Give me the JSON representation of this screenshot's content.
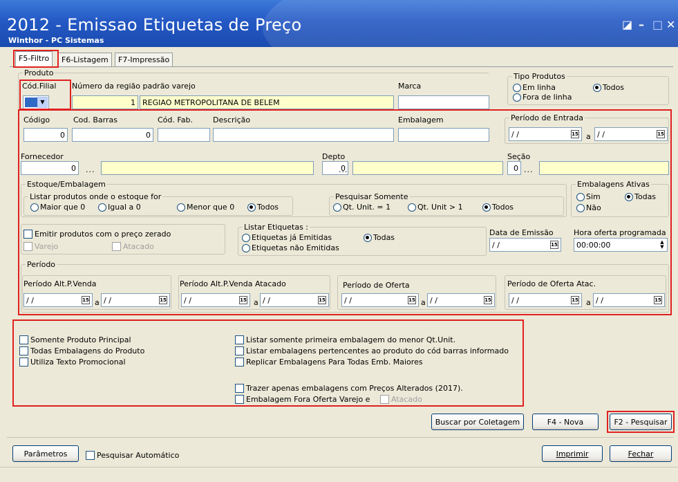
{
  "window": {
    "title": "2012 - Emissao Etiquetas de Preço",
    "subtitle": "Winthor - PC Sistemas"
  },
  "tabs": [
    "F5-Filtro",
    "F6-Listagem",
    "F7-Impressão"
  ],
  "produto": {
    "group": "Produto",
    "cod_filial_label": "Cód.Filial",
    "regiao_label": "Número da região padrão varejo",
    "regiao_num": "1",
    "regiao_name": "REGIAO METROPOLITANA DE BELEM",
    "marca_label": "Marca"
  },
  "tipo_produtos": {
    "group": "Tipo Produtos",
    "em_linha": "Em linha",
    "fora_linha": "Fora de linha",
    "todos": "Todos"
  },
  "fields": {
    "codigo_label": "Código",
    "codigo": "0",
    "barras_label": "Cod. Barras",
    "barras": "0",
    "codfab_label": "Cód. Fab.",
    "descricao_label": "Descrição",
    "embalagem_label": "Embalagem",
    "fornecedor_label": "Fornecedor",
    "fornecedor": "0",
    "depto_label": "Depto",
    "depto": "0",
    "secao_label": "Seção",
    "secao": "0",
    "ellipsis": "..."
  },
  "periodo_entrada": {
    "group": "Período de Entrada",
    "date1": "/ /",
    "date2": "/ /",
    "sep": "a",
    "cal": "15"
  },
  "estoque": {
    "group": "Estoque/Embalagem",
    "listar_group": "Listar produtos onde o estoque for",
    "opts": [
      "Maior que 0",
      "Igual a 0",
      "Menor que 0",
      "Todos"
    ],
    "pesquisar_group": "Pesquisar Somente",
    "pesq_opts": [
      "Qt. Unit. = 1",
      "Qt. Unit > 1",
      "Todos"
    ]
  },
  "emb_ativas": {
    "group": "Embalagens Ativas",
    "sim": "Sim",
    "todas": "Todas",
    "nao": "Não"
  },
  "zerado": {
    "label": "Emitir produtos com o preço zerado",
    "varejo": "Varejo",
    "atacado": "Atacado"
  },
  "listar_etiquetas": {
    "group": "Listar Etiquetas :",
    "ja": "Etiquetas já Emitidas",
    "nao": "Etiquetas não Emitidas",
    "todas": "Todas"
  },
  "emissao": {
    "label": "Data de Emissão",
    "value": "/ /",
    "hora_label": "Hora oferta programada",
    "hora": "00:00:00"
  },
  "periodo": {
    "group": "Período",
    "cols": [
      "Período Alt.P.Venda",
      "Período Alt.P.Venda Atacado",
      "Período de Oferta",
      "Período de Oferta Atac."
    ],
    "date": "/ /",
    "sep": "a",
    "cal": "15"
  },
  "options": {
    "left": [
      "Somente Produto Principal",
      "Todas Embalagens do Produto",
      "Utiliza Texto Promocional"
    ],
    "right": [
      "Listar somente primeira embalagem do menor Qt.Unit.",
      "Listar embalagens pertencentes ao produto do cód barras informado",
      "Replicar Embalagens Para Todas Emb. Maiores"
    ],
    "trazer": "Trazer apenas embalagens com Preços Alterados (2017).",
    "fora_oferta": "Embalagem Fora Oferta Varejo e",
    "atacado": "Atacado"
  },
  "buttons": {
    "coletagem": "Buscar por Coletagem",
    "nova": "F4 - Nova",
    "pesquisar": "F2 - Pesquisar",
    "parametros": "Parâmetros",
    "pesq_auto": "Pesquisar Automático",
    "imprimir": "Imprimir",
    "fechar": "Fechar"
  }
}
